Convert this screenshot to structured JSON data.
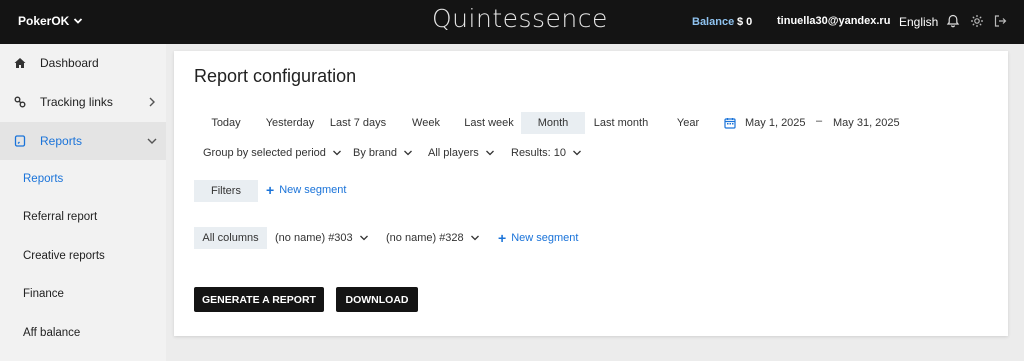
{
  "topbar": {
    "brand": "PokerOK",
    "logo": "Quintessence",
    "balance_label": "Balance",
    "balance_value": "$ 0",
    "email": "tinuella30@yandex.ru",
    "language": "English",
    "icons": [
      "bell-icon",
      "gear-icon",
      "logout-icon"
    ]
  },
  "sidebar": {
    "items": [
      {
        "label": "Dashboard",
        "icon": "home-icon"
      },
      {
        "label": "Tracking links",
        "icon": "link-icon"
      },
      {
        "label": "Reports",
        "icon": "report-icon"
      }
    ],
    "subitems": [
      "Reports",
      "Referral report",
      "Creative reports",
      "Finance",
      "Aff balance"
    ]
  },
  "card": {
    "title": "Report configuration",
    "periods": [
      "Today",
      "Yesterday",
      "Last 7 days",
      "Week",
      "Last week",
      "Month",
      "Last month",
      "Year"
    ],
    "selected_period": "Month",
    "date_from": "May 1, 2025",
    "date_separator": "–",
    "date_to": "May 31, 2025",
    "dropdowns": {
      "group_by": "Group by selected period",
      "brand": "By brand",
      "players": "All players",
      "results": "Results: 10"
    },
    "filters_label": "Filters",
    "new_segment_label": "New segment",
    "columns": {
      "all_columns": "All columns",
      "preset_1": "(no name) #303",
      "preset_2": "(no name) #328",
      "new_segment": "New segment"
    },
    "generate_label": "GENERATE A REPORT",
    "download_label": "DOWNLOAD"
  },
  "colors": {
    "topbar_bg": "#141414",
    "accent": "#1a73d9",
    "balance": "#8fc3f0",
    "selected_bg": "#e9eef2"
  }
}
